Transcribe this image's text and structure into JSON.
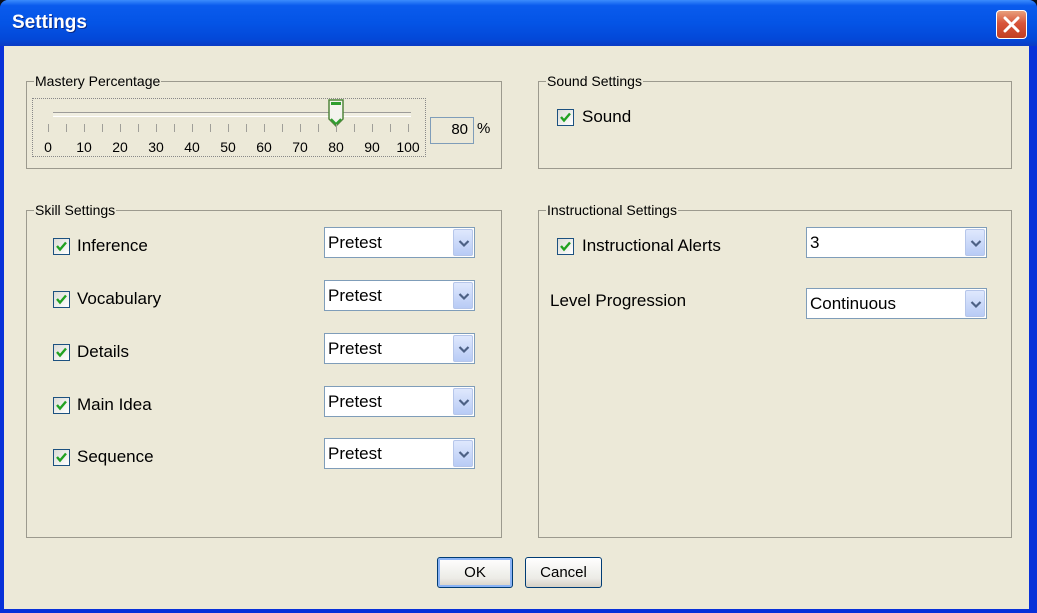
{
  "window": {
    "title": "Settings"
  },
  "mastery": {
    "group_label": "Mastery Percentage",
    "value": 80,
    "value_text": "80",
    "unit": "%",
    "ticks": [
      "0",
      "10",
      "20",
      "30",
      "40",
      "50",
      "60",
      "70",
      "80",
      "90",
      "100"
    ]
  },
  "sound": {
    "group_label": "Sound Settings",
    "checkbox_label": "Sound",
    "checked": true
  },
  "skills": {
    "group_label": "Skill Settings",
    "items": [
      {
        "label": "Inference",
        "checked": true,
        "mode": "Pretest"
      },
      {
        "label": "Vocabulary",
        "checked": true,
        "mode": "Pretest"
      },
      {
        "label": "Details",
        "checked": true,
        "mode": "Pretest"
      },
      {
        "label": "Main Idea",
        "checked": true,
        "mode": "Pretest"
      },
      {
        "label": "Sequence",
        "checked": true,
        "mode": "Pretest"
      }
    ]
  },
  "instructional": {
    "group_label": "Instructional Settings",
    "alerts_label": "Instructional Alerts",
    "alerts_checked": true,
    "alerts_value": "3",
    "progression_label": "Level Progression",
    "progression_value": "Continuous"
  },
  "buttons": {
    "ok": "OK",
    "cancel": "Cancel"
  },
  "colors": {
    "title_bar": "#0454e6",
    "dialog_bg": "#ece9d8",
    "check_mark": "#21a121",
    "close_button": "#d8553a"
  }
}
